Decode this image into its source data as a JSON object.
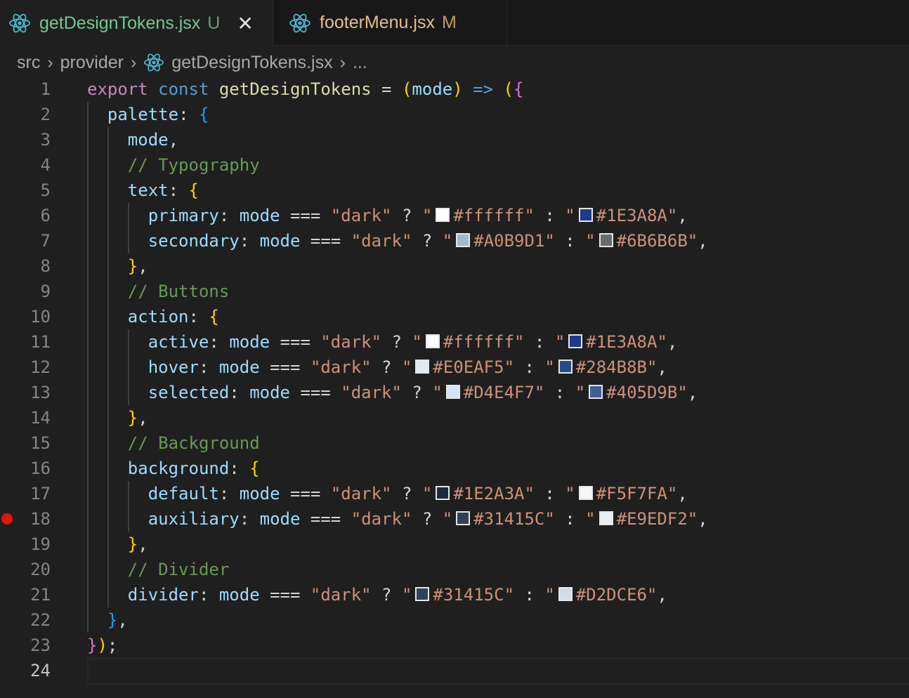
{
  "tabs": [
    {
      "label": "getDesignTokens.jsx",
      "badge": "U",
      "active": true
    },
    {
      "label": "footerMenu.jsx",
      "badge": "M",
      "active": false
    }
  ],
  "breadcrumb": [
    "src",
    "provider",
    "getDesignTokens.jsx",
    "..."
  ],
  "editor": {
    "current_line": 24,
    "breakpoint_line": 18,
    "lines": [
      [
        [
          "kw",
          "export"
        ],
        [
          "op",
          " "
        ],
        [
          "st",
          "const"
        ],
        [
          "op",
          " "
        ],
        [
          "fn",
          "getDesignTokens"
        ],
        [
          "op",
          " = "
        ],
        [
          "b1",
          "("
        ],
        [
          "var",
          "mode"
        ],
        [
          "b1",
          ")"
        ],
        [
          "op",
          " "
        ],
        [
          "st",
          "=>"
        ],
        [
          "op",
          " "
        ],
        [
          "b1",
          "("
        ],
        [
          "b2",
          "{"
        ]
      ],
      [
        [
          "op",
          "  "
        ],
        [
          "var",
          "palette"
        ],
        [
          "pn",
          ": "
        ],
        [
          "b3",
          "{"
        ]
      ],
      [
        [
          "op",
          "    "
        ],
        [
          "var",
          "mode"
        ],
        [
          "pn",
          ","
        ]
      ],
      [
        [
          "op",
          "    "
        ],
        [
          "cm",
          "// Typography"
        ]
      ],
      [
        [
          "op",
          "    "
        ],
        [
          "var",
          "text"
        ],
        [
          "pn",
          ": "
        ],
        [
          "b1",
          "{"
        ]
      ],
      [
        [
          "op",
          "      "
        ],
        [
          "var",
          "primary"
        ],
        [
          "pn",
          ": "
        ],
        [
          "var",
          "mode"
        ],
        [
          "op",
          " === "
        ],
        [
          "str",
          "\"dark\""
        ],
        [
          "op",
          " ? "
        ],
        [
          "str",
          "\""
        ],
        [
          "sw",
          "#ffffff"
        ],
        [
          "str",
          "#ffffff\""
        ],
        [
          "op",
          " : "
        ],
        [
          "str",
          "\""
        ],
        [
          "sw",
          "#1E3A8A"
        ],
        [
          "str",
          "#1E3A8A\""
        ],
        [
          "pn",
          ","
        ]
      ],
      [
        [
          "op",
          "      "
        ],
        [
          "var",
          "secondary"
        ],
        [
          "pn",
          ": "
        ],
        [
          "var",
          "mode"
        ],
        [
          "op",
          " === "
        ],
        [
          "str",
          "\"dark\""
        ],
        [
          "op",
          " ? "
        ],
        [
          "str",
          "\""
        ],
        [
          "sw",
          "#A0B9D1"
        ],
        [
          "str",
          "#A0B9D1\""
        ],
        [
          "op",
          " : "
        ],
        [
          "str",
          "\""
        ],
        [
          "sw",
          "#6B6B6B"
        ],
        [
          "str",
          "#6B6B6B\""
        ],
        [
          "pn",
          ","
        ]
      ],
      [
        [
          "op",
          "    "
        ],
        [
          "b1",
          "}"
        ],
        [
          "pn",
          ","
        ]
      ],
      [
        [
          "op",
          "    "
        ],
        [
          "cm",
          "// Buttons"
        ]
      ],
      [
        [
          "op",
          "    "
        ],
        [
          "var",
          "action"
        ],
        [
          "pn",
          ": "
        ],
        [
          "b1",
          "{"
        ]
      ],
      [
        [
          "op",
          "      "
        ],
        [
          "var",
          "active"
        ],
        [
          "pn",
          ": "
        ],
        [
          "var",
          "mode"
        ],
        [
          "op",
          " === "
        ],
        [
          "str",
          "\"dark\""
        ],
        [
          "op",
          " ? "
        ],
        [
          "str",
          "\""
        ],
        [
          "sw",
          "#ffffff"
        ],
        [
          "str",
          "#ffffff\""
        ],
        [
          "op",
          " : "
        ],
        [
          "str",
          "\""
        ],
        [
          "sw",
          "#1E3A8A"
        ],
        [
          "str",
          "#1E3A8A\""
        ],
        [
          "pn",
          ","
        ]
      ],
      [
        [
          "op",
          "      "
        ],
        [
          "var",
          "hover"
        ],
        [
          "pn",
          ": "
        ],
        [
          "var",
          "mode"
        ],
        [
          "op",
          " === "
        ],
        [
          "str",
          "\"dark\""
        ],
        [
          "op",
          " ? "
        ],
        [
          "str",
          "\""
        ],
        [
          "sw",
          "#E0EAF5"
        ],
        [
          "str",
          "#E0EAF5\""
        ],
        [
          "op",
          " : "
        ],
        [
          "str",
          "\""
        ],
        [
          "sw",
          "#284B8B"
        ],
        [
          "str",
          "#284B8B\""
        ],
        [
          "pn",
          ","
        ]
      ],
      [
        [
          "op",
          "      "
        ],
        [
          "var",
          "selected"
        ],
        [
          "pn",
          ": "
        ],
        [
          "var",
          "mode"
        ],
        [
          "op",
          " === "
        ],
        [
          "str",
          "\"dark\""
        ],
        [
          "op",
          " ? "
        ],
        [
          "str",
          "\""
        ],
        [
          "sw",
          "#D4E4F7"
        ],
        [
          "str",
          "#D4E4F7\""
        ],
        [
          "op",
          " : "
        ],
        [
          "str",
          "\""
        ],
        [
          "sw",
          "#405D9B"
        ],
        [
          "str",
          "#405D9B\""
        ],
        [
          "pn",
          ","
        ]
      ],
      [
        [
          "op",
          "    "
        ],
        [
          "b1",
          "}"
        ],
        [
          "pn",
          ","
        ]
      ],
      [
        [
          "op",
          "    "
        ],
        [
          "cm",
          "// Background"
        ]
      ],
      [
        [
          "op",
          "    "
        ],
        [
          "var",
          "background"
        ],
        [
          "pn",
          ": "
        ],
        [
          "b1",
          "{"
        ]
      ],
      [
        [
          "op",
          "      "
        ],
        [
          "var",
          "default"
        ],
        [
          "pn",
          ": "
        ],
        [
          "var",
          "mode"
        ],
        [
          "op",
          " === "
        ],
        [
          "str",
          "\"dark\""
        ],
        [
          "op",
          " ? "
        ],
        [
          "str",
          "\""
        ],
        [
          "sw",
          "#1E2A3A"
        ],
        [
          "str",
          "#1E2A3A\""
        ],
        [
          "op",
          " : "
        ],
        [
          "str",
          "\""
        ],
        [
          "sw",
          "#F5F7FA"
        ],
        [
          "str",
          "#F5F7FA\""
        ],
        [
          "pn",
          ","
        ]
      ],
      [
        [
          "op",
          "      "
        ],
        [
          "var",
          "auxiliary"
        ],
        [
          "pn",
          ": "
        ],
        [
          "var",
          "mode"
        ],
        [
          "op",
          " === "
        ],
        [
          "str",
          "\"dark\""
        ],
        [
          "op",
          " ? "
        ],
        [
          "str",
          "\""
        ],
        [
          "sw",
          "#31415C"
        ],
        [
          "str",
          "#31415C\""
        ],
        [
          "op",
          " : "
        ],
        [
          "str",
          "\""
        ],
        [
          "sw",
          "#E9EDF2"
        ],
        [
          "str",
          "#E9EDF2\""
        ],
        [
          "pn",
          ","
        ]
      ],
      [
        [
          "op",
          "    "
        ],
        [
          "b1",
          "}"
        ],
        [
          "pn",
          ","
        ]
      ],
      [
        [
          "op",
          "    "
        ],
        [
          "cm",
          "// Divider"
        ]
      ],
      [
        [
          "op",
          "    "
        ],
        [
          "var",
          "divider"
        ],
        [
          "pn",
          ": "
        ],
        [
          "var",
          "mode"
        ],
        [
          "op",
          " === "
        ],
        [
          "str",
          "\"dark\""
        ],
        [
          "op",
          " ? "
        ],
        [
          "str",
          "\""
        ],
        [
          "sw",
          "#31415C"
        ],
        [
          "str",
          "#31415C\""
        ],
        [
          "op",
          " : "
        ],
        [
          "str",
          "\""
        ],
        [
          "sw",
          "#D2DCE6"
        ],
        [
          "str",
          "#D2DCE6\""
        ],
        [
          "pn",
          ","
        ]
      ],
      [
        [
          "op",
          "  "
        ],
        [
          "b3",
          "}"
        ],
        [
          "pn",
          ","
        ]
      ],
      [
        [
          "b2",
          "}"
        ],
        [
          "b1",
          ")"
        ],
        [
          "pn",
          ";"
        ]
      ],
      []
    ],
    "guides": [
      [],
      [
        0
      ],
      [
        0,
        1
      ],
      [
        0,
        1
      ],
      [
        0,
        1
      ],
      [
        0,
        1,
        2
      ],
      [
        0,
        1,
        2
      ],
      [
        0,
        1
      ],
      [
        0,
        1
      ],
      [
        0,
        1
      ],
      [
        0,
        1,
        2
      ],
      [
        0,
        1,
        2
      ],
      [
        0,
        1,
        2
      ],
      [
        0,
        1
      ],
      [
        0,
        1
      ],
      [
        0,
        1
      ],
      [
        0,
        1,
        2
      ],
      [
        0,
        1,
        2
      ],
      [
        0,
        1
      ],
      [
        0,
        1
      ],
      [
        0,
        1
      ],
      [
        0
      ],
      [],
      []
    ]
  }
}
